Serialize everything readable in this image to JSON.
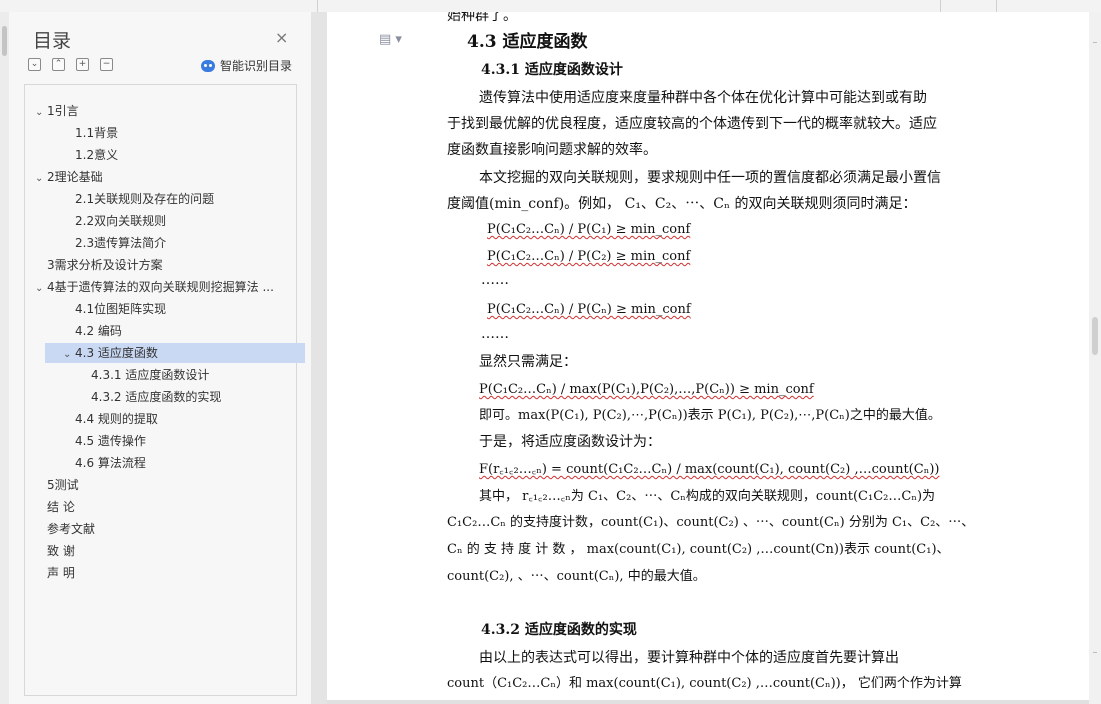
{
  "nav": {
    "title": "目录",
    "close_glyph": "×",
    "toolbar": {
      "collapse_all": "⌄",
      "expand_up": "⌃",
      "add": "+",
      "remove": "−"
    },
    "smart_toc_label": "智能识别目录",
    "items": [
      {
        "label": "1引言",
        "level": 1,
        "expanded": true
      },
      {
        "label": "1.1背景",
        "level": 2
      },
      {
        "label": "1.2意义",
        "level": 2
      },
      {
        "label": "2理论基础",
        "level": 1,
        "expanded": true
      },
      {
        "label": "2.1关联规则及存在的问题",
        "level": 2
      },
      {
        "label": "2.2双向关联规则",
        "level": 2
      },
      {
        "label": "2.3遗传算法简介",
        "level": 2
      },
      {
        "label": "3需求分析及设计方案",
        "level": 1
      },
      {
        "label": "4基于遗传算法的双向关联规则挖掘算法 ...",
        "level": 1,
        "expanded": true
      },
      {
        "label": "4.1位图矩阵实现",
        "level": 2
      },
      {
        "label": "4.2  编码",
        "level": 2
      },
      {
        "label": "4.3  适应度函数",
        "level": 2,
        "expanded": true,
        "selected": true
      },
      {
        "label": "4.3.1  适应度函数设计",
        "level": 3
      },
      {
        "label": "4.3.2  适应度函数的实现",
        "level": 3
      },
      {
        "label": "4.4  规则的提取",
        "level": 2
      },
      {
        "label": "4.5  遗传操作",
        "level": 2
      },
      {
        "label": "4.6  算法流程",
        "level": 2
      },
      {
        "label": "5测试",
        "level": 1
      },
      {
        "label": "结      论",
        "level": 1
      },
      {
        "label": "参考文献",
        "level": 1
      },
      {
        "label": "致      谢",
        "level": 1
      },
      {
        "label": "声      明",
        "level": 1
      }
    ]
  },
  "doc": {
    "top_cut": "始种群了。",
    "h_43": "4.3  适应度函数",
    "h_431": "4.3.1 适应度函数设计",
    "p1": [
      "遗传算法中使用适应度来度量种群中各个体在优化计算中可能达到或有助",
      "于找到最优解的优良程度，适应度较高的个体遗传到下一代的概率就较大。适应",
      "度函数直接影响问题求解的效率。"
    ],
    "p2": [
      "本文挖掘的双向关联规则，要求规则中任一项的置信度都必须满足最小置信",
      "度阈值(min_conf)。例如，  C₁、C₂、⋯、Cₙ 的双向关联规则须同时满足："
    ],
    "f1": "P(C₁C₂…Cₙ) / P(C₁)  ≥  min_conf",
    "f2": "P(C₁C₂…Cₙ) / P(C₂)  ≥  min_conf",
    "dots1": "……",
    "f3": "P(C₁C₂…Cₙ) / P(Cₙ)  ≥  min_conf",
    "dots2": "……",
    "obvious": "显然只需满足：",
    "f4": "P(C₁C₂…Cₙ) / max(P(C₁),P(C₂),…,P(Cₙ))  ≥  min_conf",
    "p3": "即可。max(P(C₁), P(C₂),⋯,P(Cₙ))表示 P(C₁), P(C₂),⋯,P(Cₙ)之中的最大值。",
    "p4": "于是，将适应度函数设计为：",
    "f5": "F(r꜀₁꜀₂…꜀ₙ) = count(C₁C₂…Cₙ) / max(count(C₁), count(C₂) ,…count(Cₙ))",
    "p5": [
      "其中，   r꜀₁꜀₂…꜀ₙ为 C₁、C₂、⋯、Cₙ构成的双向关联规则，count(C₁C₂…Cₙ)为",
      "C₁C₂…Cₙ 的支持度计数，count(C₁)、count(C₂) 、⋯、count(Cₙ) 分别为 C₁、C₂、⋯、",
      "Cₙ 的 支 持 度 计 数 ，   max(count(C₁), count(C₂) ,…count(Cn))表示 count(C₁)、",
      "count(C₂), 、⋯、count(Cₙ), 中的最大值。"
    ],
    "h_432": "4.3.2 适应度函数的实现",
    "p6": [
      "由以上的表达式可以得出，要计算种群中个体的适应度首先要计算出",
      "count（C₁C₂…Cₙ）和 max(count(C₁), count(C₂) ,…count(Cₙ))， 它们两个作为计算"
    ]
  }
}
